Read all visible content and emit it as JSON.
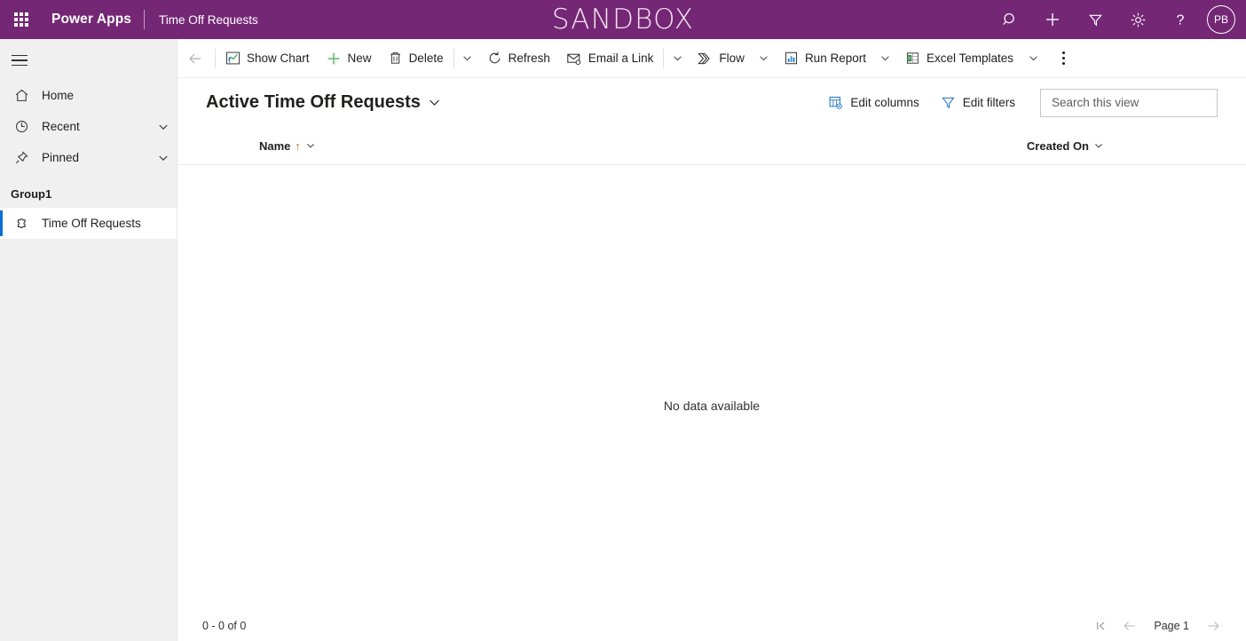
{
  "header": {
    "waffle_label": "app-launcher",
    "brand": "Power Apps",
    "app_name": "Time Off Requests",
    "environment_banner": "SANDBOX",
    "avatar_initials": "PB",
    "icons": [
      "search-icon",
      "plus-icon",
      "filter-icon",
      "gear-icon",
      "help-icon"
    ],
    "accent_color": "#742774"
  },
  "sidebar": {
    "items": [
      {
        "label": "Home",
        "icon": "home-icon",
        "expandable": false
      },
      {
        "label": "Recent",
        "icon": "clock-icon",
        "expandable": true
      },
      {
        "label": "Pinned",
        "icon": "pin-icon",
        "expandable": true
      }
    ],
    "group_label": "Group1",
    "entity": {
      "label": "Time Off Requests",
      "icon": "puzzle-icon",
      "selected": true
    },
    "selected_accent": "#0b6dd7",
    "background": "#f0f0f0"
  },
  "commandbar": {
    "back_label": "back-arrow",
    "buttons": [
      {
        "label": "Show Chart",
        "icon": "chart-icon",
        "caret": false
      },
      {
        "label": "New",
        "icon": "plus-green-icon",
        "caret": false
      },
      {
        "label": "Delete",
        "icon": "trash-icon",
        "caret": true
      },
      {
        "label": "Refresh",
        "icon": "refresh-icon",
        "caret": false
      },
      {
        "label": "Email a Link",
        "icon": "email-link-icon",
        "caret": true
      },
      {
        "label": "Flow",
        "icon": "flow-icon",
        "caret": true
      },
      {
        "label": "Run Report",
        "icon": "report-icon",
        "caret": true
      },
      {
        "label": "Excel Templates",
        "icon": "excel-icon",
        "caret": true
      }
    ],
    "overflow_label": "more-commands"
  },
  "view": {
    "title": "Active Time Off Requests",
    "edit_columns_label": "Edit columns",
    "edit_filters_label": "Edit filters",
    "search_placeholder": "Search this view",
    "search_value": ""
  },
  "grid": {
    "columns": [
      {
        "label": "Name",
        "sort": "ascending",
        "sort_glyph": "↑"
      },
      {
        "label": "Created On",
        "sort": "none"
      }
    ],
    "rows": [],
    "empty_message": "No data available"
  },
  "footer": {
    "record_count": "0 - 0 of 0",
    "page_label": "Page 1",
    "first_page_icon": "first-page-icon",
    "prev_page_icon": "previous-page-icon",
    "next_page_icon": "next-page-icon"
  }
}
